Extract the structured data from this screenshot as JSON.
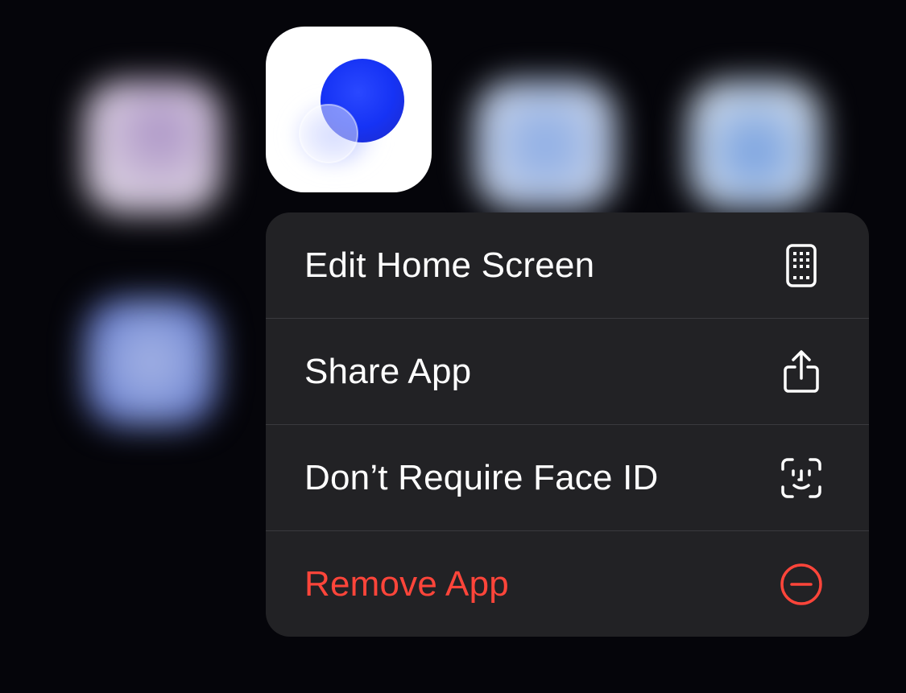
{
  "colors": {
    "background": "#05050a",
    "menu_background": "#222225",
    "divider": "#3a3a3e",
    "text_primary": "#ffffff",
    "destructive": "#ff453a",
    "app_accent": "#1a3dff"
  },
  "app_icon": {
    "icon": "blue-orb-app-icon"
  },
  "background_icons": [
    {
      "icon": "blurred-app-icon-purple"
    },
    {
      "icon": "blurred-app-icon-blue"
    },
    {
      "icon": "blurred-app-icon-light-blue"
    },
    {
      "icon": "blurred-app-icon-indigo"
    }
  ],
  "menu": {
    "items": [
      {
        "label": "Edit Home Screen",
        "icon": "home-screen-grid-icon",
        "destructive": false
      },
      {
        "label": "Share App",
        "icon": "share-icon",
        "destructive": false
      },
      {
        "label": "Don’t Require Face ID",
        "icon": "face-id-icon",
        "destructive": false
      },
      {
        "label": "Remove App",
        "icon": "minus-circle-icon",
        "destructive": true
      }
    ]
  }
}
